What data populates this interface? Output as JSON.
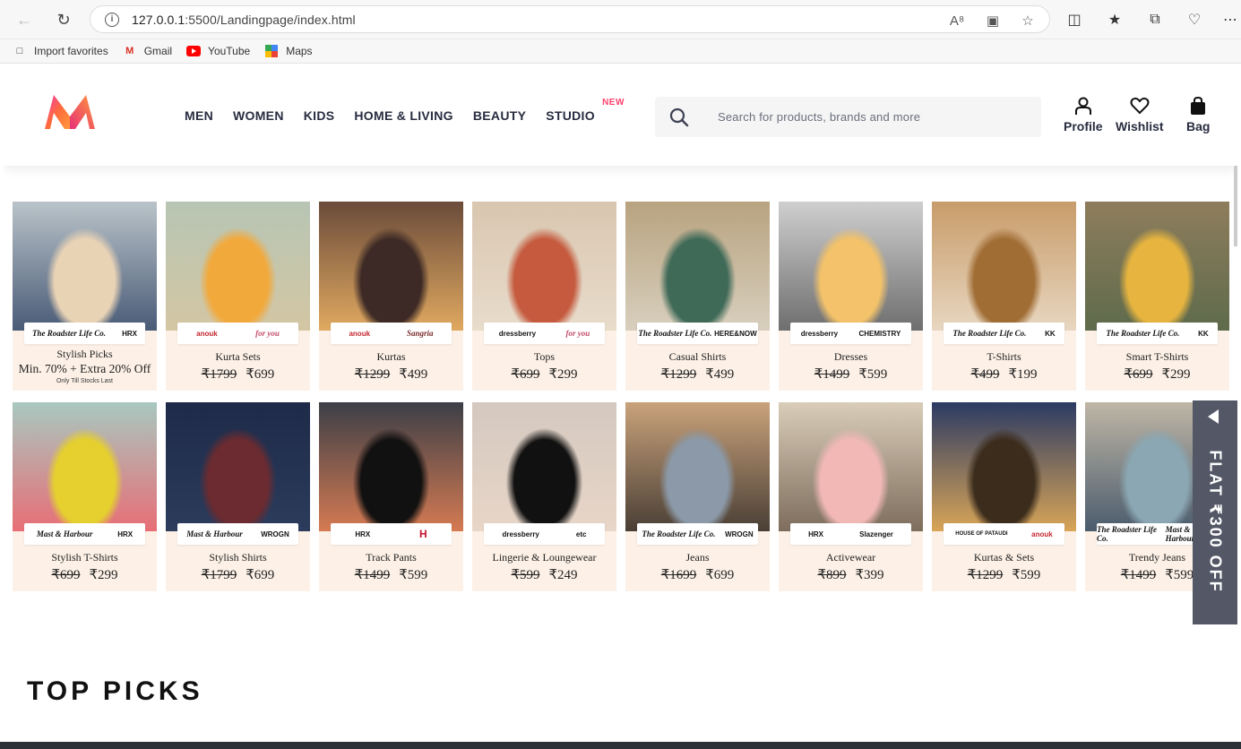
{
  "browser": {
    "url_host": "127.0.0.1",
    "url_rest": ":5500/Landingpage/index.html",
    "bookmarks": [
      "Import favorites",
      "Gmail",
      "YouTube",
      "Maps"
    ]
  },
  "header": {
    "menu": [
      "MEN",
      "WOMEN",
      "KIDS",
      "HOME & LIVING",
      "BEAUTY",
      "STUDIO"
    ],
    "new_badge": "NEW",
    "search_placeholder": "Search for products, brands and more",
    "actions": [
      "Profile",
      "Wishlist",
      "Bag"
    ]
  },
  "row1": [
    {
      "title": "Stylish Picks",
      "offer": "Min. 70% + Extra 20% Off",
      "note": "Only Till Stocks Last",
      "brands": [
        "The Roadster Life Co.",
        "HRX"
      ]
    },
    {
      "title": "Kurta Sets",
      "old": "₹1799",
      "new": "₹699",
      "brands": [
        "anouk",
        "for you"
      ]
    },
    {
      "title": "Kurtas",
      "old": "₹1299",
      "new": "₹499",
      "brands": [
        "anouk",
        "Sangria"
      ]
    },
    {
      "title": "Tops",
      "old": "₹699",
      "new": "₹299",
      "brands": [
        "dressberry",
        "for you"
      ]
    },
    {
      "title": "Casual Shirts",
      "old": "₹1299",
      "new": "₹499",
      "brands": [
        "The Roadster Life Co.",
        "HERE&NOW"
      ]
    },
    {
      "title": "Dresses",
      "old": "₹1499",
      "new": "₹599",
      "brands": [
        "dressberry",
        "CHEMISTRY"
      ]
    },
    {
      "title": "T-Shirts",
      "old": "₹499",
      "new": "₹199",
      "brands": [
        "The Roadster Life Co.",
        "KK"
      ]
    },
    {
      "title": "Smart T-Shirts",
      "old": "₹699",
      "new": "₹299",
      "brands": [
        "The Roadster Life Co.",
        "KK"
      ]
    }
  ],
  "row2": [
    {
      "title": "Stylish T-Shirts",
      "old": "₹699",
      "new": "₹299",
      "brands": [
        "Mast & Harbour",
        "HRX"
      ]
    },
    {
      "title": "Stylish Shirts",
      "old": "₹1799",
      "new": "₹699",
      "brands": [
        "Mast & Harbour",
        "WROGN"
      ]
    },
    {
      "title": "Track Pants",
      "old": "₹1499",
      "new": "₹599",
      "brands": [
        "HRX",
        "H"
      ]
    },
    {
      "title": "Lingerie & Loungewear",
      "old": "₹599",
      "new": "₹249",
      "brands": [
        "dressberry",
        "etc"
      ]
    },
    {
      "title": "Jeans",
      "old": "₹1699",
      "new": "₹699",
      "brands": [
        "The Roadster Life Co.",
        "WROGN"
      ]
    },
    {
      "title": "Activewear",
      "old": "₹899",
      "new": "₹399",
      "brands": [
        "HRX",
        "Slazenger"
      ]
    },
    {
      "title": "Kurtas & Sets",
      "old": "₹1299",
      "new": "₹599",
      "brands": [
        "HOUSE OF PATAUDI",
        "anouk"
      ]
    },
    {
      "title": "Trendy Jeans",
      "old": "₹1499",
      "new": "₹599",
      "brands": [
        "The Roadster Life Co.",
        "Mast & Harbour"
      ]
    }
  ],
  "flat_offer": "FLAT ₹300 OFF",
  "section_title": "TOP PICKS",
  "colors": {
    "accent": "#ff3f6c",
    "card_bg": "#fdf1e7",
    "flat_tab": "#535766",
    "logo_orange": "#ff9a3c",
    "logo_pink": "#e72e77"
  },
  "images": [
    [
      "#b9c3c9",
      "#e9d3b5",
      "#4a5b77"
    ],
    [
      "#b7c5b4",
      "#f2a93c",
      "#d4c6a3"
    ],
    [
      "#6b4b3a",
      "#3d2a26",
      "#e0a960"
    ],
    [
      "#d9c6b0",
      "#c55a3e",
      "#e8dccb"
    ],
    [
      "#b8a37f",
      "#3f6a58",
      "#d8cfbe"
    ],
    [
      "#cfcfcf",
      "#f3c26a",
      "#6e6e6e"
    ],
    [
      "#c89c6a",
      "#a06d35",
      "#e8d7c1"
    ],
    [
      "#8e7d5c",
      "#e6b43f",
      "#5e6b4c"
    ],
    [
      "#a8c8c0",
      "#e5d02f",
      "#e86e76"
    ],
    [
      "#1e2a48",
      "#6b2b30",
      "#2c3c5c"
    ],
    [
      "#3c3f47",
      "#111111",
      "#d57a52"
    ],
    [
      "#d4c8bf",
      "#111111",
      "#e8d6c8"
    ],
    [
      "#c9a27b",
      "#8b99a8",
      "#4a3f35"
    ],
    [
      "#d9cdb9",
      "#f1b8b6",
      "#7e6d5c"
    ],
    [
      "#2c3b63",
      "#3b2c1c",
      "#d9a557"
    ],
    [
      "#bfb6a6",
      "#8aa7b3",
      "#4b5c6d"
    ]
  ]
}
